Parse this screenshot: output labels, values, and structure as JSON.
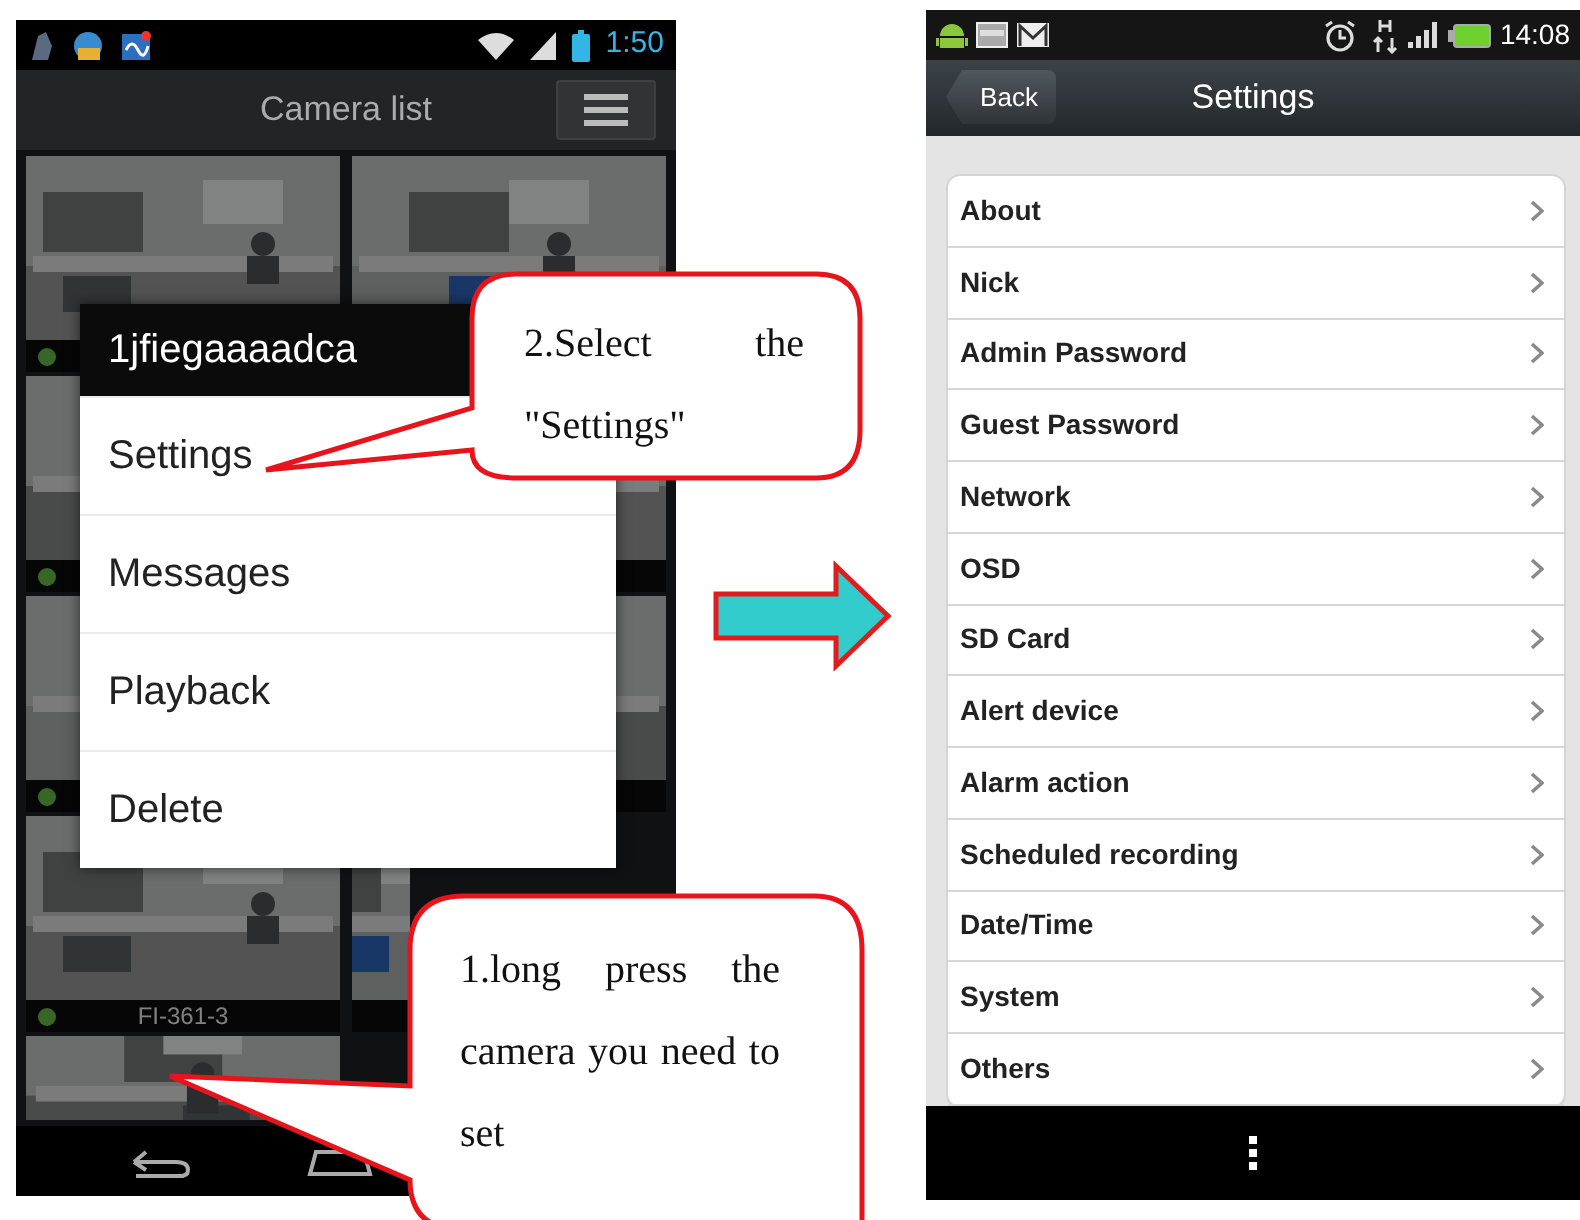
{
  "left_screen": {
    "status_bar": {
      "time": "1:50"
    },
    "title": "Camera list",
    "cameras": [
      {
        "kind": "picture",
        "online": true
      },
      {
        "kind": "picture"
      },
      {
        "kind": "picture",
        "online": true
      },
      {
        "kind": "picture"
      },
      {
        "kind": "picture",
        "online": true
      },
      {
        "kind": "picture"
      },
      {
        "kind": "picture",
        "online": true,
        "label": "FI-361-3"
      },
      {
        "kind": "picture"
      },
      {
        "kind": "picture"
      }
    ],
    "dialog": {
      "title": "1jfiegaaaadca",
      "items": [
        "Settings",
        "Messages",
        "Playback",
        "Delete"
      ]
    }
  },
  "callouts": [
    {
      "text": "2.Select the \"Settings\""
    },
    {
      "text": "1.long press the camera you need to set"
    }
  ],
  "right_screen": {
    "status_bar": {
      "time": "14:08"
    },
    "back": "Back",
    "title": "Settings",
    "items": [
      "About",
      "Nick",
      "Admin Password",
      "Guest Password",
      "Network",
      "OSD",
      "SD Card",
      "Alert device",
      "Alarm action",
      "Scheduled recording",
      "Date/Time",
      "System",
      "Others"
    ]
  }
}
